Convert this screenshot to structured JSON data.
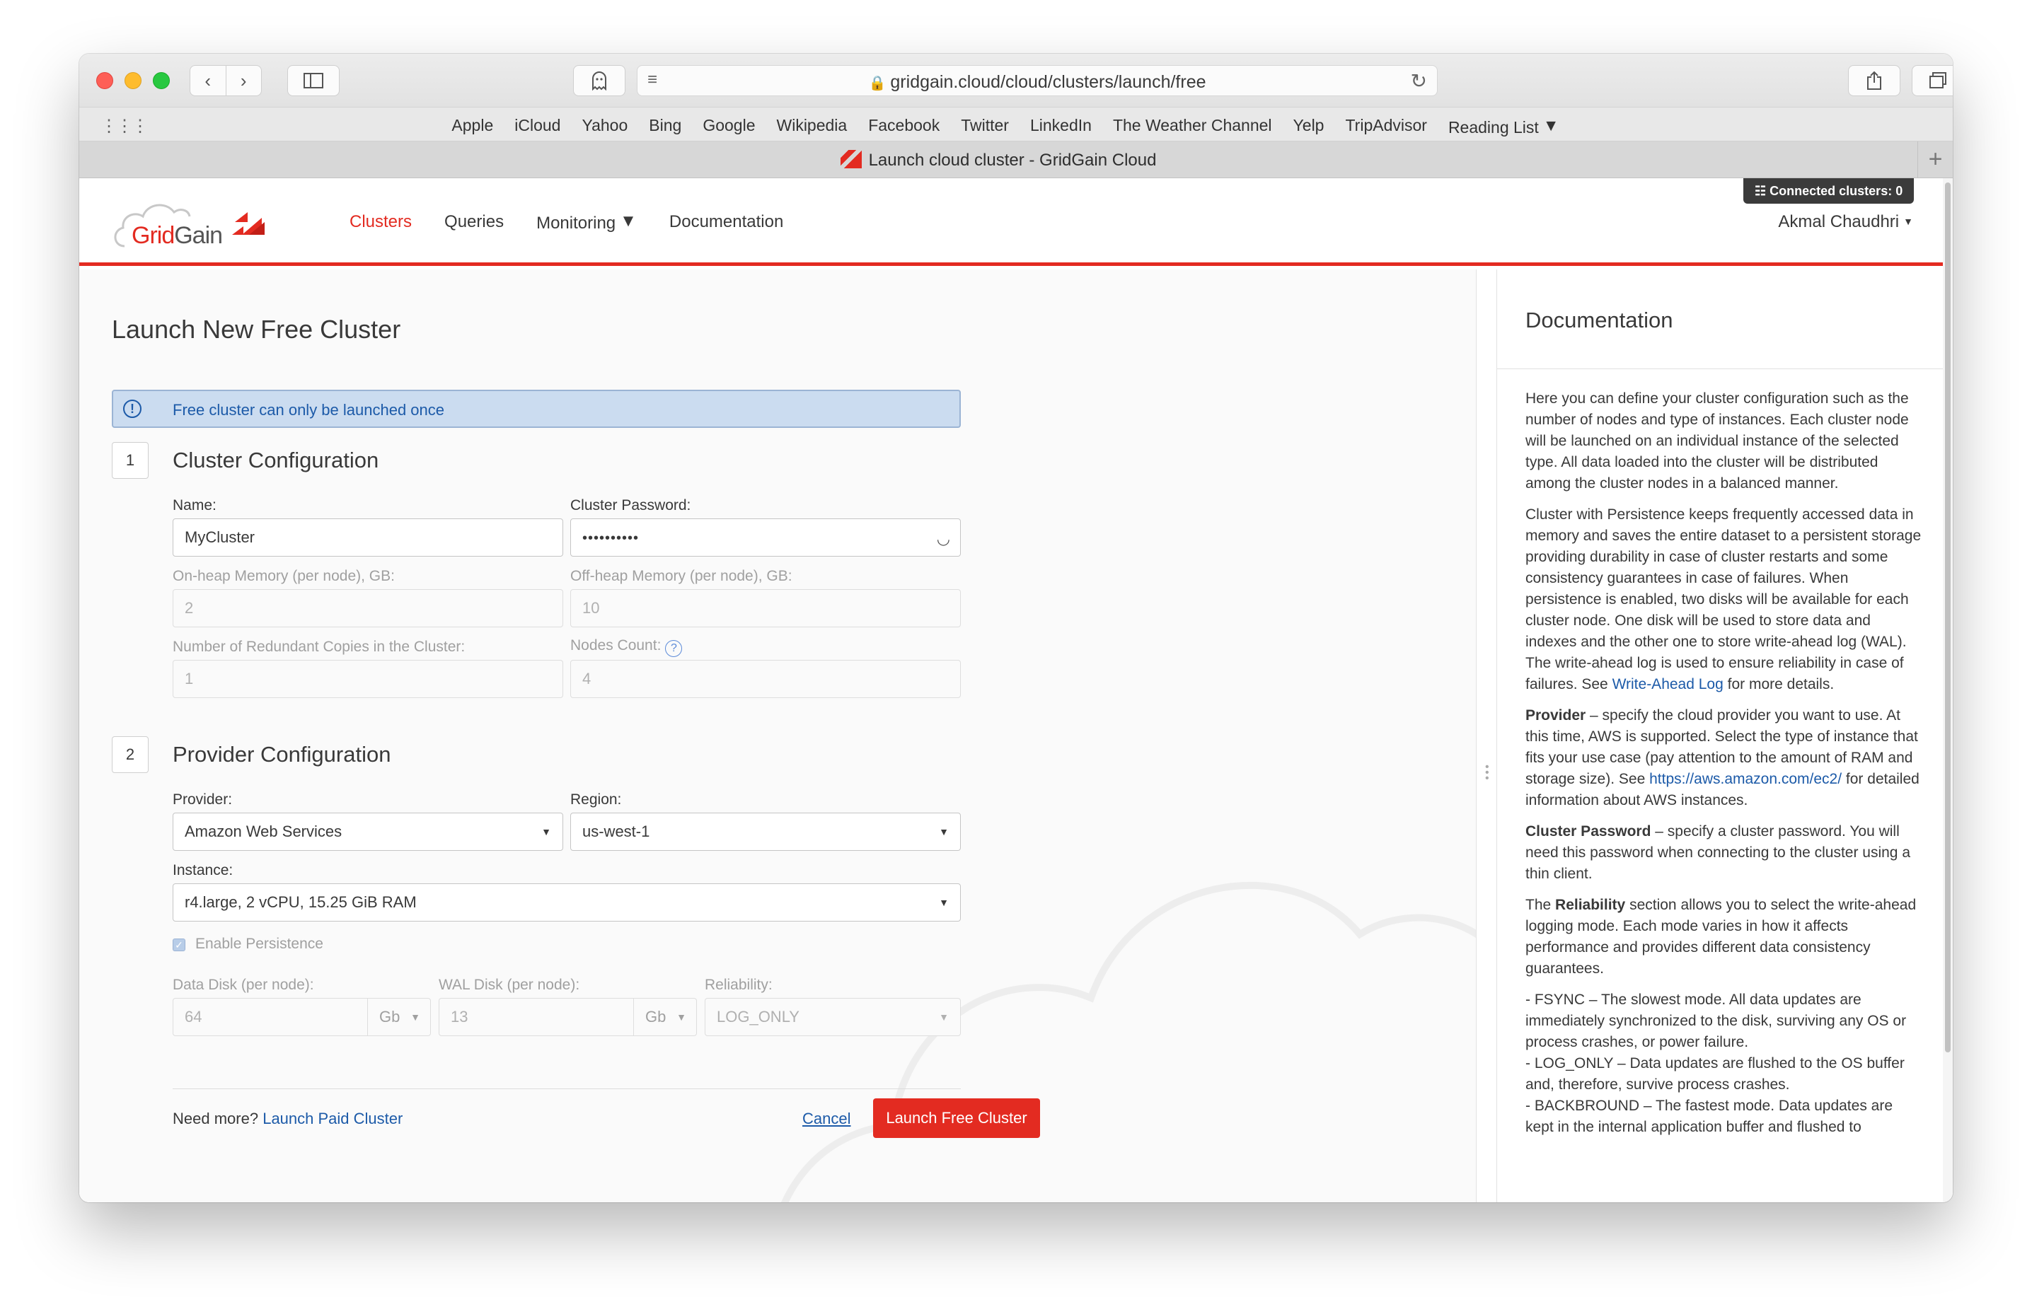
{
  "browser": {
    "url": "gridgain.cloud/cloud/clusters/launch/free",
    "tab_title": "Launch cloud cluster - GridGain Cloud",
    "favorites": [
      "Apple",
      "iCloud",
      "Yahoo",
      "Bing",
      "Google",
      "Wikipedia",
      "Facebook",
      "Twitter",
      "LinkedIn",
      "The Weather Channel",
      "Yelp",
      "TripAdvisor",
      "Reading List"
    ]
  },
  "header": {
    "logo_text_grid": "Grid",
    "logo_text_gain": "Gain",
    "nav": [
      "Clusters",
      "Queries",
      "Monitoring",
      "Documentation"
    ],
    "connected_clusters": "Connected clusters: 0",
    "user": "Akmal Chaudhri"
  },
  "form": {
    "title": "Launch New Free Cluster",
    "alert": "Free cluster can only be launched once",
    "section1": {
      "num": "1",
      "title": "Cluster Configuration",
      "name_label": "Name:",
      "name_value": "MyCluster",
      "password_label": "Cluster Password:",
      "password_value": "••••••••••",
      "onheap_label": "On-heap Memory (per node), GB:",
      "onheap_value": "2",
      "offheap_label": "Off-heap Memory (per node), GB:",
      "offheap_value": "10",
      "copies_label": "Number of Redundant Copies in the Cluster:",
      "copies_value": "1",
      "nodes_label": "Nodes Count:",
      "nodes_value": "4"
    },
    "section2": {
      "num": "2",
      "title": "Provider Configuration",
      "provider_label": "Provider:",
      "provider_value": "Amazon Web Services",
      "region_label": "Region:",
      "region_value": "us-west-1",
      "instance_label": "Instance:",
      "instance_value": "r4.large, 2 vCPU, 15.25 GiB RAM",
      "persistence_label": "Enable Persistence",
      "data_disk_label": "Data Disk (per node):",
      "data_disk_value": "64",
      "data_disk_unit": "Gb",
      "wal_disk_label": "WAL Disk (per node):",
      "wal_disk_value": "13",
      "wal_disk_unit": "Gb",
      "reliability_label": "Reliability:",
      "reliability_value": "LOG_ONLY"
    },
    "footer": {
      "need_more": "Need more?",
      "paid_link": "Launch Paid Cluster",
      "cancel": "Cancel",
      "launch": "Launch Free Cluster"
    }
  },
  "docs": {
    "title": "Documentation",
    "p1": "Here you can define your cluster configuration such as the number of nodes and type of instances. Each cluster node will be launched on an individual instance of the selected type. All data loaded into the cluster will be distributed among the cluster nodes in a balanced manner.",
    "p2": "Cluster with Persistence keeps frequently accessed data in memory and saves the entire dataset to a persistent storage providing durability in case of cluster restarts and some consistency guarantees in case of failures. When persistence is enabled, two disks will be available for each cluster node. One disk will be used to store data and indexes and the other one to store write-ahead log (WAL). The write-ahead log is used to ensure reliability in case of failures. See",
    "p2_link": "Write-Ahead Log",
    "p2_end": "for more details.",
    "p3_bold": "Provider",
    "p3": "– specify the cloud provider you want to use. At this time, AWS is supported. Select the type of instance that fits your use case (pay attention to the amount of RAM and storage size). See",
    "p3_link": "https://aws.amazon.com/ec2/",
    "p3_end": "for detailed information about AWS instances.",
    "p4_bold": "Cluster Password",
    "p4": "– specify a cluster password. You will need this password when connecting to the cluster using a thin client.",
    "p5_start": "The",
    "p5_bold": "Reliability",
    "p5": "section allows you to select the write-ahead logging mode. Each mode varies in how it affects performance and provides different data consistency guarantees.",
    "p6": "- FSYNC – The slowest mode. All data updates are immediately synchronized to the disk, surviving any OS or process crashes, or power failure.",
    "p7": "- LOG_ONLY – Data updates are flushed to the OS buffer and, therefore, survive process crashes.",
    "p8": "- BACKBROUND – The fastest mode. Data updates are kept in the internal application buffer and flushed to"
  }
}
